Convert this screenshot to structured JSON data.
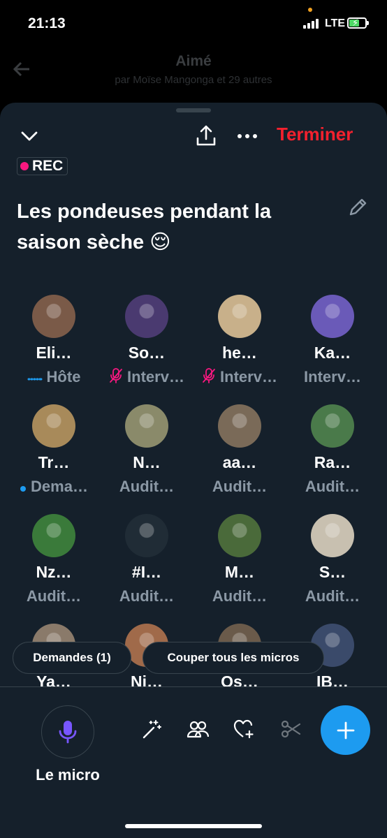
{
  "status": {
    "time": "21:13",
    "network": "LTE"
  },
  "behind": {
    "title": "Aimé",
    "subtitle": "par Moïse Mangonga et 29 autres"
  },
  "header": {
    "end_label": "Terminer"
  },
  "rec": {
    "label": "REC"
  },
  "space": {
    "title": "Les pondeuses pendant la saison sèche 😌"
  },
  "participants": [
    {
      "name": "Eli…",
      "role": "Hôte",
      "role_icon": "speaking-icon",
      "avatar": "#7a5a48"
    },
    {
      "name": "So…",
      "role": "Interv…",
      "role_icon": "mic-muted-icon",
      "avatar": "#4a3a70"
    },
    {
      "name": "he…",
      "role": "Interv…",
      "role_icon": "mic-muted-icon",
      "avatar": "#c8b08a"
    },
    {
      "name": "Ka…",
      "role": "Interv…",
      "role_icon": "",
      "avatar": "#6a5ab8"
    },
    {
      "name": "Tr…",
      "role": "Dema…",
      "role_icon": "request-dot-icon",
      "avatar": "#a88a5a"
    },
    {
      "name": "N…",
      "role": "Audit…",
      "role_icon": "",
      "avatar": "#8a8a6a"
    },
    {
      "name": "aa…",
      "role": "Audit…",
      "role_icon": "",
      "avatar": "#7a6a58"
    },
    {
      "name": "Ra…",
      "role": "Audit…",
      "role_icon": "",
      "avatar": "#4a7a4a"
    },
    {
      "name": "Nz…",
      "role": "Audit…",
      "role_icon": "",
      "avatar": "#3a7a3a"
    },
    {
      "name": "#I…",
      "role": "Audit…",
      "role_icon": "",
      "avatar": "#202c36"
    },
    {
      "name": "M…",
      "role": "Audit…",
      "role_icon": "",
      "avatar": "#4a6a3a"
    },
    {
      "name": "S…",
      "role": "Audit…",
      "role_icon": "",
      "avatar": "#c8c0b0"
    },
    {
      "name": "Ya…",
      "role": "",
      "role_icon": "",
      "avatar": "#8a7a6a"
    },
    {
      "name": "Ni…",
      "role": "",
      "role_icon": "",
      "avatar": "#a06a4a"
    },
    {
      "name": "Os…",
      "role": "",
      "role_icon": "",
      "avatar": "#6a5a4a"
    },
    {
      "name": "IB…",
      "role": "",
      "role_icon": "",
      "avatar": "#3a4a6a"
    }
  ],
  "actions": {
    "requests_label": "Demandes (1)",
    "mute_all_label": "Couper tous les micros"
  },
  "toolbar": {
    "mic_label": "Le micro"
  },
  "colors": {
    "accent": "#1d9bf0",
    "danger": "#f4212e",
    "rec": "#f91880",
    "sheet": "#15202b",
    "mic": "#7856ff"
  }
}
